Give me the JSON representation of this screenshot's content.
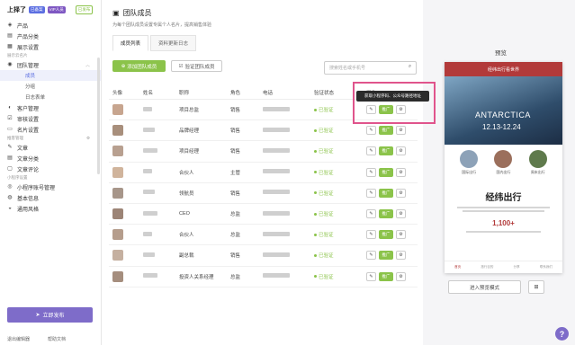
{
  "brand": {
    "logo": "上择了",
    "tag1": "已备案",
    "tag2": "VIP人员",
    "tag3": "已发布"
  },
  "sidebar": {
    "items_top": [
      {
        "label": "产品",
        "icon": "cube-icon"
      },
      {
        "label": "产品分类",
        "icon": "folder-icon"
      },
      {
        "label": "展示设置",
        "icon": "grid-icon"
      }
    ],
    "group1": "展示云名片",
    "team": {
      "label": "团队管理",
      "subs": [
        "成员",
        "分组",
        "日志表单"
      ],
      "active": "成员"
    },
    "items_mid": [
      {
        "label": "客户管理",
        "icon": "users-icon"
      },
      {
        "label": "审核设置",
        "icon": "check-icon"
      },
      {
        "label": "名片设置",
        "icon": "card-icon"
      }
    ],
    "group2": "推客管理",
    "items_content": [
      {
        "label": "文章",
        "icon": "doc-icon"
      },
      {
        "label": "文章分类",
        "icon": "folder-icon"
      },
      {
        "label": "文章评论",
        "icon": "comment-icon"
      }
    ],
    "group3": "小程序设置",
    "items_mini": [
      {
        "label": "小程序账号管理",
        "icon": "account-icon"
      },
      {
        "label": "基本信息",
        "icon": "info-icon"
      },
      {
        "label": "通用风格",
        "icon": "palette-icon"
      }
    ],
    "publish": "立即发布",
    "bottom_left": "退出编辑器",
    "bottom_right": "帮助文档"
  },
  "main": {
    "title": "团队成员",
    "subtitle": "为每个团队成员设置专属个人名片，提高销售体验",
    "tabs": [
      "成员列表",
      "资料更新日志"
    ],
    "add_button": "添加团队成员",
    "verify_button": "验证团队成员",
    "search_placeholder": "搜索姓名或手机号",
    "columns": [
      "头像",
      "姓名",
      "职称",
      "角色",
      "电话",
      "验证状态",
      "操作"
    ],
    "rows": [
      {
        "title": "项目总监",
        "role": "销售",
        "status": "已验证"
      },
      {
        "title": "品牌经理",
        "role": "销售",
        "status": "已验证"
      },
      {
        "title": "项目经理",
        "role": "销售",
        "status": "已验证"
      },
      {
        "title": "合伙人",
        "role": "主管",
        "status": "已验证"
      },
      {
        "title": "领航员",
        "role": "销售",
        "status": "已验证"
      },
      {
        "title": "CEO",
        "role": "总监",
        "status": "已验证"
      },
      {
        "title": "合伙人",
        "role": "总监",
        "status": "已验证"
      },
      {
        "title": "副总裁",
        "role": "销售",
        "status": "已验证"
      },
      {
        "title": "投资人关系经理",
        "role": "总监",
        "status": "已验证"
      }
    ],
    "promo_label": "推广",
    "tooltip": "获取小程序码、公众号路径地址"
  },
  "preview": {
    "label": "预览",
    "bar_title": "经纬出行看世界",
    "hero_title": "ANTARCTICA",
    "hero_date": "12.13-12.24",
    "icons": [
      "国际出行",
      "国内出行",
      "周末出行"
    ],
    "heading": "经纬出行",
    "number": "1,100+",
    "tabbar": [
      "首页",
      "旅行目的",
      "分享",
      "联系我们"
    ],
    "enter_button": "进入预览模式",
    "qr_icon": "⊞"
  },
  "help": "?"
}
